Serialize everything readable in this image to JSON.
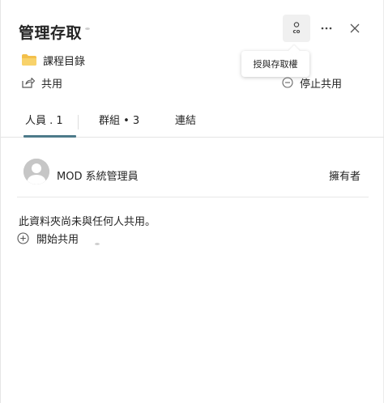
{
  "panel": {
    "title": "管理存取",
    "grant_button_label": "co",
    "tooltip": "授與存取權"
  },
  "item": {
    "folder_name": "課程目錄"
  },
  "actions": {
    "share_label": "共用",
    "stop_share_label": "停止共用"
  },
  "tabs": [
    {
      "label": "人員 . 1",
      "active": true
    },
    {
      "label": "群組 • 3",
      "active": false
    },
    {
      "label": "連結",
      "active": false
    }
  ],
  "members": [
    {
      "name": "MOD 系統管理員",
      "role": "擁有者"
    }
  ],
  "empty_state": {
    "message": "此資料夾尚未與任何人共用。",
    "start_share_label": "開始共用"
  },
  "colors": {
    "tab_indicator": "#4d7a8a",
    "folder": "#f3c04b"
  }
}
